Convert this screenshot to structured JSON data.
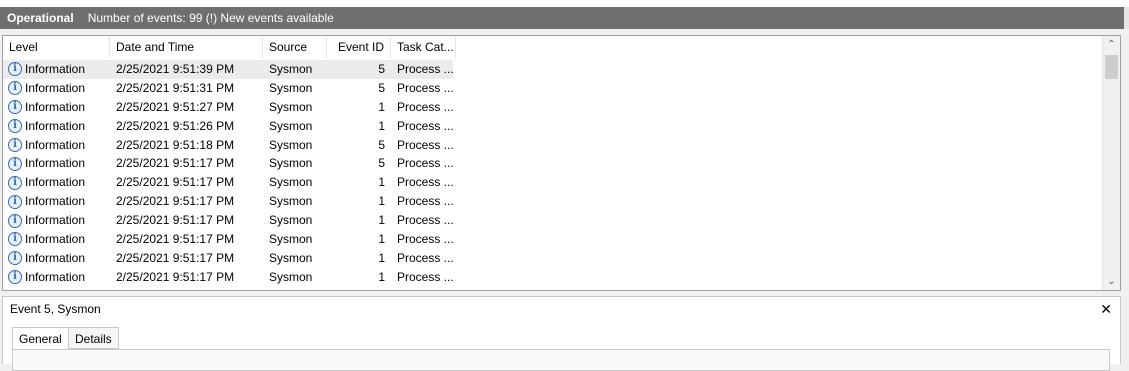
{
  "header": {
    "title": "Operational",
    "info": "Number of events: 99 (!) New events available"
  },
  "columns": {
    "level": "Level",
    "datetime": "Date and Time",
    "source": "Source",
    "event_id": "Event ID",
    "task_category": "Task Cat..."
  },
  "rows": [
    {
      "level": "Information",
      "datetime": "2/25/2021 9:51:39 PM",
      "source": "Sysmon",
      "event_id": "5",
      "task": "Process ..."
    },
    {
      "level": "Information",
      "datetime": "2/25/2021 9:51:31 PM",
      "source": "Sysmon",
      "event_id": "5",
      "task": "Process ..."
    },
    {
      "level": "Information",
      "datetime": "2/25/2021 9:51:27 PM",
      "source": "Sysmon",
      "event_id": "1",
      "task": "Process ..."
    },
    {
      "level": "Information",
      "datetime": "2/25/2021 9:51:26 PM",
      "source": "Sysmon",
      "event_id": "1",
      "task": "Process ..."
    },
    {
      "level": "Information",
      "datetime": "2/25/2021 9:51:18 PM",
      "source": "Sysmon",
      "event_id": "5",
      "task": "Process ..."
    },
    {
      "level": "Information",
      "datetime": "2/25/2021 9:51:17 PM",
      "source": "Sysmon",
      "event_id": "5",
      "task": "Process ..."
    },
    {
      "level": "Information",
      "datetime": "2/25/2021 9:51:17 PM",
      "source": "Sysmon",
      "event_id": "1",
      "task": "Process ..."
    },
    {
      "level": "Information",
      "datetime": "2/25/2021 9:51:17 PM",
      "source": "Sysmon",
      "event_id": "1",
      "task": "Process ..."
    },
    {
      "level": "Information",
      "datetime": "2/25/2021 9:51:17 PM",
      "source": "Sysmon",
      "event_id": "1",
      "task": "Process ..."
    },
    {
      "level": "Information",
      "datetime": "2/25/2021 9:51:17 PM",
      "source": "Sysmon",
      "event_id": "1",
      "task": "Process ..."
    },
    {
      "level": "Information",
      "datetime": "2/25/2021 9:51:17 PM",
      "source": "Sysmon",
      "event_id": "1",
      "task": "Process ..."
    },
    {
      "level": "Information",
      "datetime": "2/25/2021 9:51:17 PM",
      "source": "Sysmon",
      "event_id": "1",
      "task": "Process ..."
    }
  ],
  "icons": {
    "level": "information-icon",
    "scroll_up": "chevron-up-icon",
    "scroll_down": "chevron-down-icon",
    "close": "close-icon"
  },
  "detail": {
    "title": "Event 5, Sysmon",
    "close_label": "✕",
    "tabs": [
      "General",
      "Details"
    ]
  }
}
